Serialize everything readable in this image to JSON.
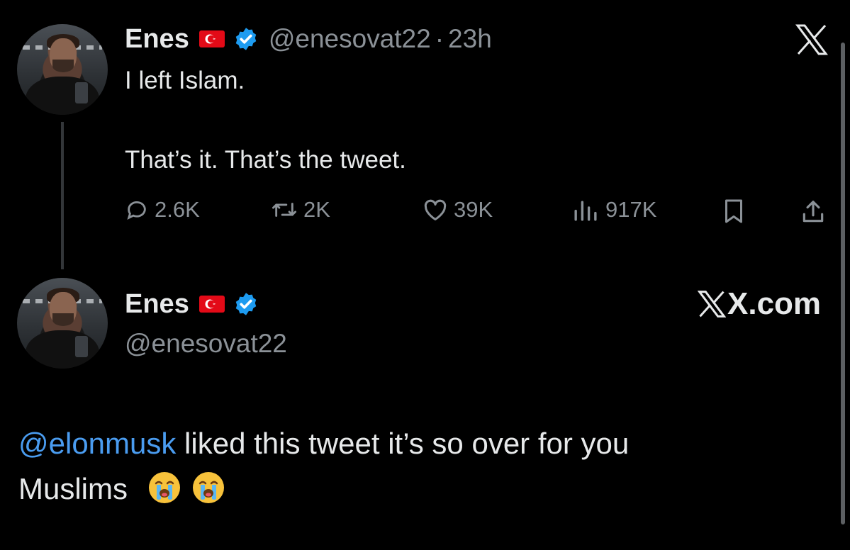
{
  "tweet": {
    "author_name": "Enes",
    "handle": "@enesovat22",
    "dot": "·",
    "time": "23h",
    "line1": "I left Islam.",
    "line2": "That’s it. That’s the tweet.",
    "replies": "2.6K",
    "retweets": "2K",
    "likes": "39K",
    "views": "917K"
  },
  "profile_card": {
    "author_name": "Enes",
    "handle": "@enesovat22",
    "site": "X.com"
  },
  "caption": {
    "mention": "@elonmusk",
    "text_rest": " liked this tweet it’s so over for you",
    "line2": "Muslims"
  },
  "icons": {
    "logo": "x-logo-icon",
    "verified": "verified-badge-icon",
    "flag": "turkey-flag-icon",
    "reply": "reply-icon",
    "retweet": "retweet-icon",
    "like": "heart-icon",
    "views": "views-icon",
    "bookmark": "bookmark-icon",
    "share": "share-icon",
    "emoji": "loudly-crying-face-icon"
  },
  "colors": {
    "background": "#000000",
    "text": "#e7e9ea",
    "muted": "#8b9197",
    "mention": "#4a9cf0",
    "verified": "#1d9bf0",
    "flag": "#e30a17"
  }
}
